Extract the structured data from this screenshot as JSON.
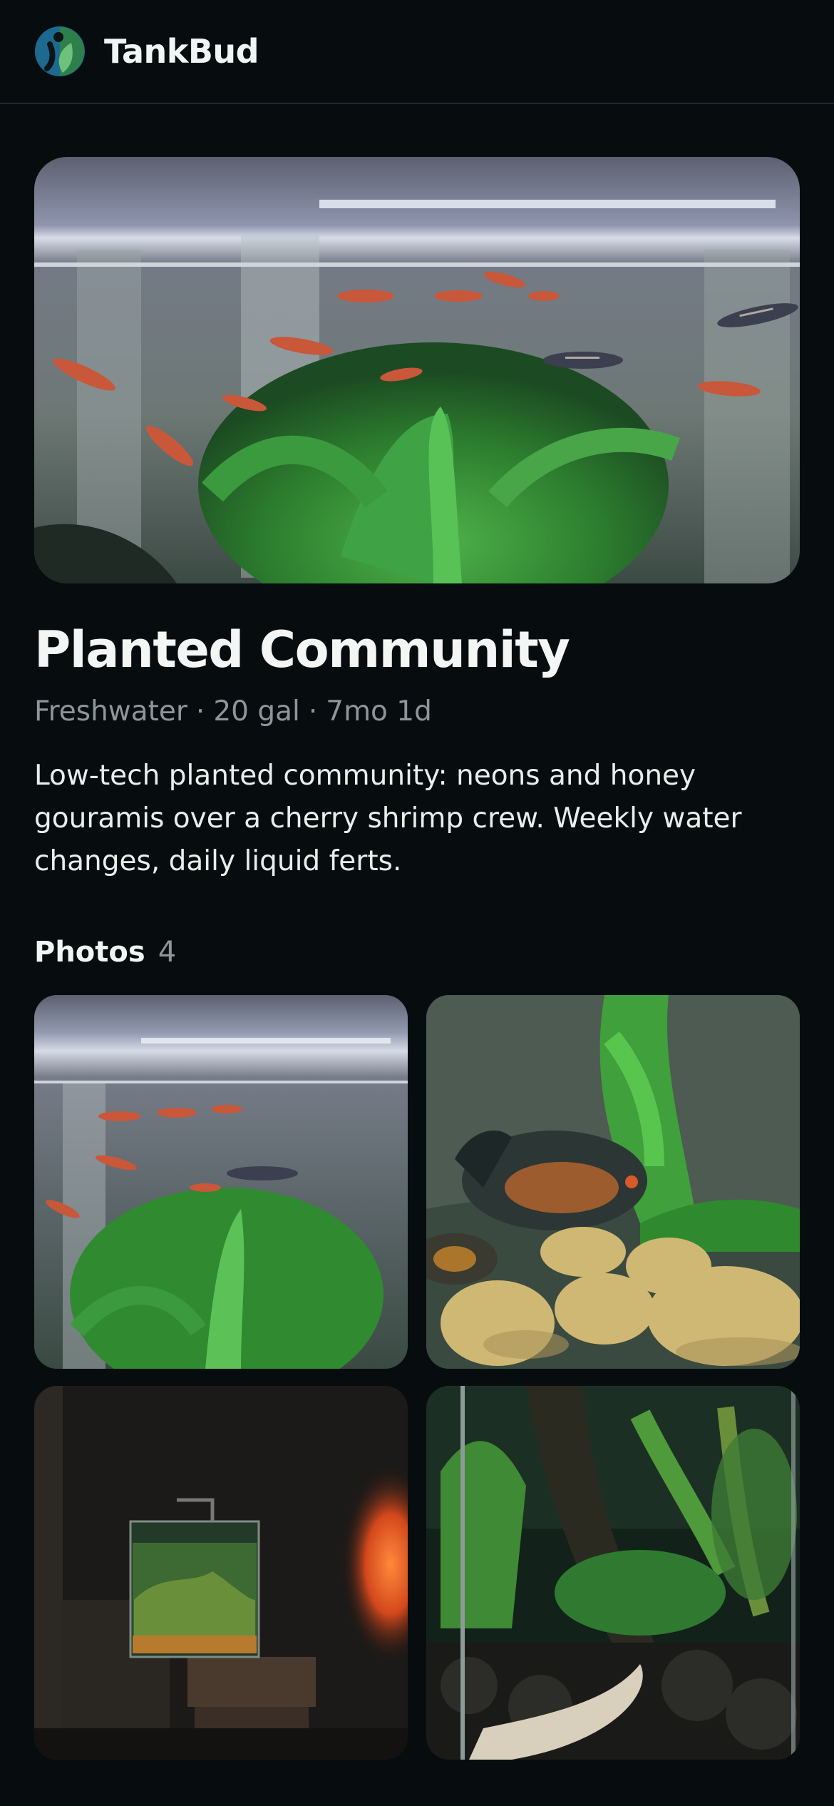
{
  "header": {
    "app_name": "TankBud",
    "logo_icon": "tankbud-logo-icon"
  },
  "tank": {
    "name": "Planted Community",
    "water_type": "Freshwater",
    "volume": "20 gal",
    "age": "7mo 1d",
    "separator": "·",
    "description": "Low-tech planted community: neons and honey gouramis over a cherry shrimp crew. Weekly water changes, daily liquid ferts."
  },
  "photos": {
    "label": "Photos",
    "count": "4"
  },
  "colors": {
    "background": "#070d0f",
    "muted_text": "#8c9799",
    "logo_blue": "#1c6a8f",
    "logo_green": "#3f8f56"
  }
}
